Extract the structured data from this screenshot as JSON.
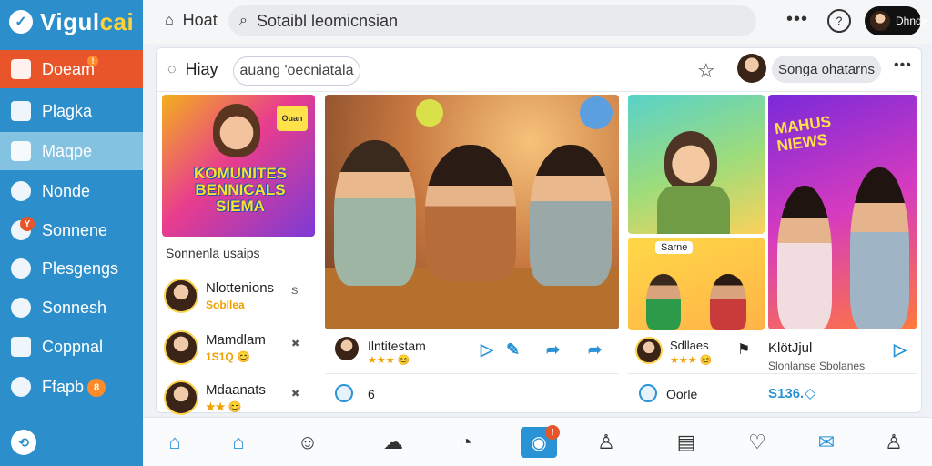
{
  "app": {
    "logo_main": "Vigul",
    "logo_accent": "cai"
  },
  "sidebar": {
    "items": [
      {
        "label": "Doeam",
        "icon": "grid-icon",
        "badge": "!",
        "state": "active"
      },
      {
        "label": "Plagka",
        "icon": "image-icon"
      },
      {
        "label": "Maqpe",
        "icon": "card-icon",
        "state": "highlighted"
      },
      {
        "label": "Nonde",
        "icon": "globe-icon"
      },
      {
        "label": "Sonnene",
        "icon": "bell-icon",
        "badge": "Y"
      },
      {
        "label": "Plesgengs",
        "icon": "chat-icon"
      },
      {
        "label": "Sonnesh",
        "icon": "headset-icon"
      },
      {
        "label": "Coppnal",
        "icon": "book-icon"
      },
      {
        "label": "Ffapb",
        "icon": "cart-icon",
        "badge": "8"
      }
    ],
    "bottom_icon": "compass-icon"
  },
  "topbar": {
    "home_label": "Hoat",
    "search_text": "Sotaibl leomicnsian",
    "profile_label": "Dhnde"
  },
  "panel": {
    "title": "Hiay",
    "search_text": "auang 'oecniatala",
    "user_chip": "Songa ohatarns"
  },
  "featured_card": {
    "art_title": "KOMUNITES BENNICALS SIEMA",
    "art_sign": "Ouan"
  },
  "members": {
    "heading": "Sonnenla usaips",
    "items": [
      {
        "name": "Nlottenions",
        "meta": "Sobllea",
        "side": "S"
      },
      {
        "name": "Mamdlam",
        "meta": "1S1Q 😊",
        "side": "✖"
      },
      {
        "name": "Mdaanats",
        "meta": "★★ 😊",
        "side": "✖"
      }
    ]
  },
  "video_card": {
    "author": "Ilntitestam",
    "rating": "★★★ 😊",
    "count": "6"
  },
  "right_cards": {
    "top_art_title": "MAHUS NIEWS",
    "mini_label": "Sarne",
    "author": "Sdllaes",
    "rating": "★★★ 😊",
    "foot_text": "Oorle",
    "promo_title": "KlötJjul",
    "promo_sub": "Slonlanse Sbolanes",
    "price": "S136."
  },
  "bottom_nav": [
    "home-icon",
    "house-icon",
    "people-icon",
    "cloud-icon",
    "timer-icon",
    "camera-icon",
    "user-icon",
    "document-icon",
    "gift-icon",
    "mail-icon",
    "profile-icon"
  ],
  "colors": {
    "sidebar": "#2c8fcc",
    "active": "#e8552a",
    "accent": "#2a93d5",
    "badge": "#ff8a2a"
  }
}
